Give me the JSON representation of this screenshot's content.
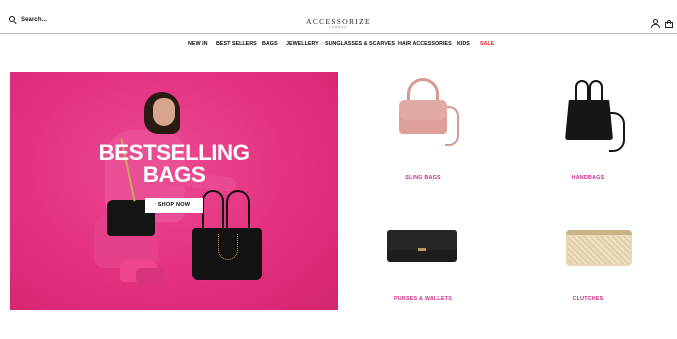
{
  "header": {
    "search_label": "Search...",
    "logo_text": "ACCESSORIZE",
    "logo_subtext": "LONDON",
    "account_icon": "user-icon",
    "bag_icon": "shopping-bag-icon"
  },
  "nav": {
    "items": [
      "NEW IN",
      "BEST SELLERS",
      "BAGS",
      "JEWELLERY",
      "SUNGLASSES & SCARVES",
      "HAIR ACCESSORIES",
      "KIDS",
      "SALE"
    ],
    "sale_color": "#e2242f"
  },
  "hero": {
    "title_line1": "BESTSELLING",
    "title_line2": "BAGS",
    "button_label": "SHOP NOW",
    "background_color": "#e3307f"
  },
  "categories": [
    {
      "label": "SLING BAGS"
    },
    {
      "label": "HANDBAGS"
    },
    {
      "label": "PURSES & WALLETS"
    },
    {
      "label": "CLUTCHES"
    }
  ],
  "colors": {
    "category_label": "#cc2f86",
    "header_border": "#bdbdbd"
  }
}
